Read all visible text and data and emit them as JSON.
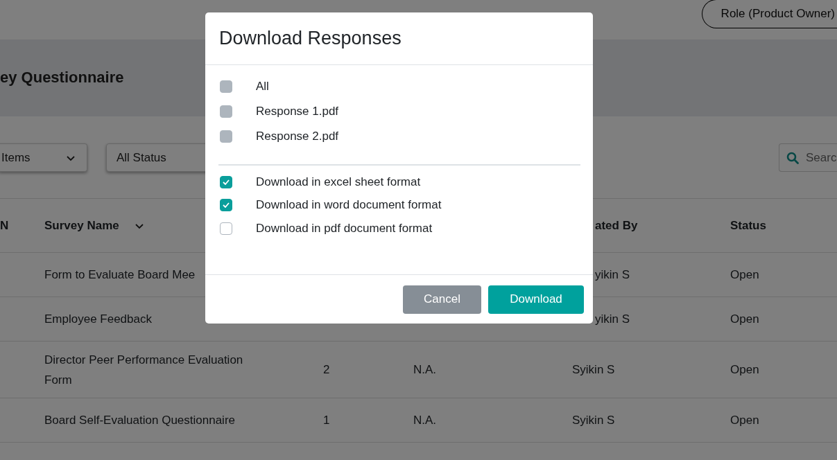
{
  "top_bar": {
    "role_button": "Role (Product Owner)"
  },
  "page_title": "ey Questionnaire",
  "filters": {
    "items_dropdown": "Items",
    "status_dropdown": "All Status",
    "search": {
      "placeholder": "Searc"
    }
  },
  "table": {
    "header": {
      "column_1": "N",
      "survey_name": {
        "text": "Survey Name",
        "sortable": true
      },
      "created_by": {
        "text": "ated By",
        "partly_covered": true
      },
      "status": "Status"
    },
    "rows": [
      {
        "survey_name": "Form to Evaluate Board Mee",
        "created_by": {
          "text": "yikin S",
          "partly_covered": true
        },
        "status": "Open"
      },
      {
        "survey_name": "Employee Feedback",
        "created_by": {
          "text": "yikin S",
          "partly_covered": true
        },
        "status": "Open"
      },
      {
        "survey_name": "Director Peer Performance Evaluation Form",
        "column_3": "2",
        "column_4": "N.A.",
        "created_by": {
          "text": "Syikin S",
          "partly_covered": false
        },
        "status": "Open"
      },
      {
        "survey_name": "Board Self-Evaluation Questionnaire",
        "column_3": "1",
        "column_4": "N.A.",
        "created_by": {
          "text": "Syikin S",
          "partly_covered": false
        },
        "status": "Open"
      }
    ]
  },
  "dialog": {
    "title": "Download Responses",
    "files": [
      {
        "label": "All",
        "checked": false,
        "disabled": true
      },
      {
        "label": "Response 1.pdf",
        "checked": false,
        "disabled": true
      },
      {
        "label": "Response 2.pdf",
        "checked": false,
        "disabled": true
      }
    ],
    "formats": [
      {
        "label": "Download in excel sheet format",
        "checked": true,
        "disabled": false
      },
      {
        "label": "Download in word document format",
        "checked": true,
        "disabled": false
      },
      {
        "label": "Download in pdf document format",
        "checked": false,
        "disabled": false
      }
    ],
    "buttons": [
      {
        "label": "Cancel",
        "kind": "secondary"
      },
      {
        "label": "Download",
        "kind": "primary"
      }
    ]
  }
}
